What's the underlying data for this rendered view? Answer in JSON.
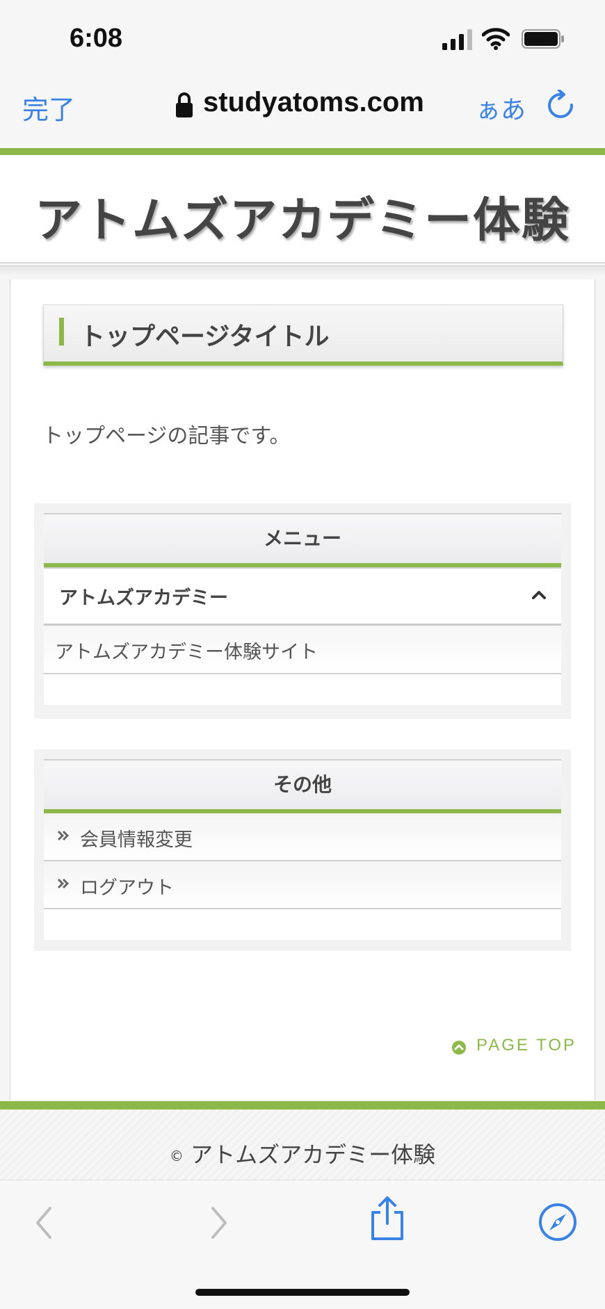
{
  "status_bar": {
    "time": "6:08"
  },
  "browser": {
    "done_label": "完了",
    "domain": "studyatoms.com",
    "text_size_label": "ぁあ"
  },
  "site": {
    "title": "アトムズアカデミー体験",
    "page_heading": "トップページタイトル",
    "article_text": "トップページの記事です。",
    "menu_widget": {
      "title": "メニュー",
      "accordion_label": "アトムズアカデミー",
      "links": [
        "アトムズアカデミー体験サイト"
      ]
    },
    "other_widget": {
      "title": "その他",
      "links": [
        "会員情報変更",
        "ログアウト"
      ]
    },
    "page_top_label": "PAGE TOP",
    "copyright_symbol": "©",
    "copyright_text": "アトムズアカデミー体験"
  },
  "colors": {
    "accent_green": "#8cb84a",
    "ios_blue": "#3a82e6"
  },
  "icons": [
    "signal-icon",
    "wifi-icon",
    "battery-icon",
    "lock-icon",
    "reload-icon",
    "chevron-up-icon",
    "double-chevron-icon",
    "page-top-icon",
    "back-icon",
    "forward-icon",
    "share-icon",
    "compass-icon"
  ]
}
